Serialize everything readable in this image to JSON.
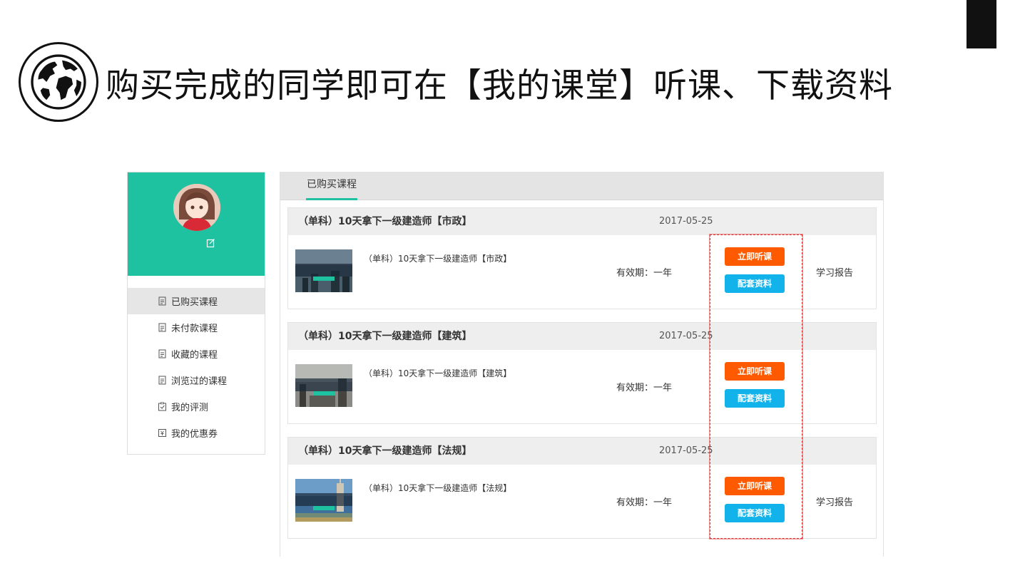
{
  "headline": {
    "text": "购买完成的同学即可在【我的课堂】听课、下载资料",
    "icon": "globe-icon"
  },
  "sidebar": {
    "items": [
      {
        "label": "已购买课程",
        "icon": "document-icon",
        "active": true
      },
      {
        "label": "未付款课程",
        "icon": "document-icon",
        "active": false
      },
      {
        "label": "收藏的课程",
        "icon": "document-icon",
        "active": false
      },
      {
        "label": "浏览过的课程",
        "icon": "document-icon",
        "active": false
      },
      {
        "label": "我的评测",
        "icon": "checklist-icon",
        "active": false
      },
      {
        "label": "我的优惠券",
        "icon": "coupon-icon",
        "active": false
      }
    ]
  },
  "tabs": [
    {
      "label": "已购买课程",
      "active": true
    }
  ],
  "courses": [
    {
      "title": "（单科）10天拿下一级建造师【市政】",
      "date": "2017-05-25",
      "subtitle": "（单科）10天拿下一级建造师【市政】",
      "validity": "有效期：一年",
      "listen_label": "立即听课",
      "material_label": "配套资料",
      "report_label": "学习报告"
    },
    {
      "title": "（单科）10天拿下一级建造师【建筑】",
      "date": "2017-05-25",
      "subtitle": "（单科）10天拿下一级建造师【建筑】",
      "validity": "有效期：一年",
      "listen_label": "立即听课",
      "material_label": "配套资料",
      "report_label": ""
    },
    {
      "title": "（单科）10天拿下一级建造师【法规】",
      "date": "2017-05-25",
      "subtitle": "（单科）10天拿下一级建造师【法规】",
      "validity": "有效期：一年",
      "listen_label": "立即听课",
      "material_label": "配套资料",
      "report_label": "学习报告"
    }
  ],
  "colors": {
    "brand_green": "#1fc2a0",
    "listen_orange": "#ff5a00",
    "material_blue": "#12b3ea",
    "highlight_red": "#e03030"
  }
}
